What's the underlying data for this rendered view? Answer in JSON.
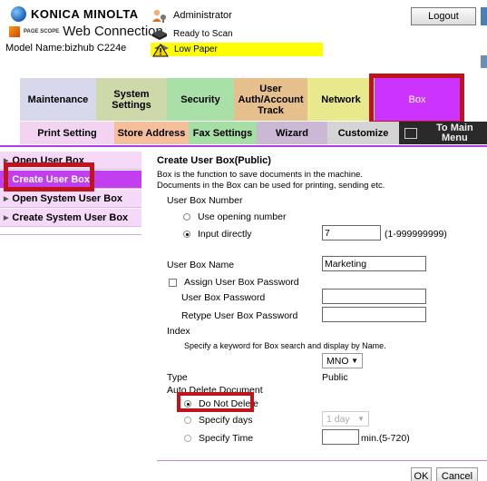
{
  "header": {
    "brand": "KONICA MINOLTA",
    "page_scope": "PAGE SCOPE",
    "web_connection": "Web Connection",
    "model_name": "Model Name:bizhub C224e",
    "user": "Administrator",
    "status_scan": "Ready to Scan",
    "status_paper": "Low Paper",
    "logout_label": "Logout",
    "paper_status_color": "#ffff00"
  },
  "tabs": [
    {
      "label": "Maintenance"
    },
    {
      "label": "System Settings"
    },
    {
      "label": "Security"
    },
    {
      "label": "User Auth/Account Track"
    },
    {
      "label": "Network"
    },
    {
      "label": "Box"
    }
  ],
  "subtabs": [
    {
      "label": "Print Setting"
    },
    {
      "label": "Store Address"
    },
    {
      "label": "Fax Settings"
    },
    {
      "label": "Wizard"
    },
    {
      "label": "Customize"
    },
    {
      "label": "To Main Menu"
    }
  ],
  "sidebar": {
    "items": [
      {
        "label": "Open User Box"
      },
      {
        "label": "Create User Box"
      },
      {
        "label": "Open System User Box"
      },
      {
        "label": "Create System User Box"
      }
    ]
  },
  "main": {
    "title": "Create User Box(Public)",
    "desc1": "Box is the function to save documents in the machine.",
    "desc2": "Documents in the Box can be used for printing, sending etc.",
    "box_number_label": "User Box Number",
    "opt_opening": "Use opening number",
    "opt_direct": "Input directly",
    "box_number_value": "7",
    "box_number_range": "(1-999999999)",
    "box_name_label": "User Box Name",
    "box_name_value": "Marketing",
    "assign_password": "Assign User Box Password",
    "password_label": "User Box Password",
    "retype_label": "Retype User Box Password",
    "index_label": "Index",
    "index_hint": "Specify a keyword for Box search and display by Name.",
    "index_value": "MNO",
    "type_label": "Type",
    "type_value": "Public",
    "auto_delete_label": "Auto Delete Document",
    "opt_do_not_delete": "Do Not Delete",
    "opt_specify_days": "Specify days",
    "days_value": "1 day",
    "opt_specify_time": "Specify Time",
    "time_range": "min.(5-720)",
    "ok_label": "OK",
    "cancel_label": "Cancel"
  },
  "colors": {
    "accent_box": "#cc33ff",
    "highlight": "#c0141c",
    "sidebar_active": "#c13fef"
  }
}
